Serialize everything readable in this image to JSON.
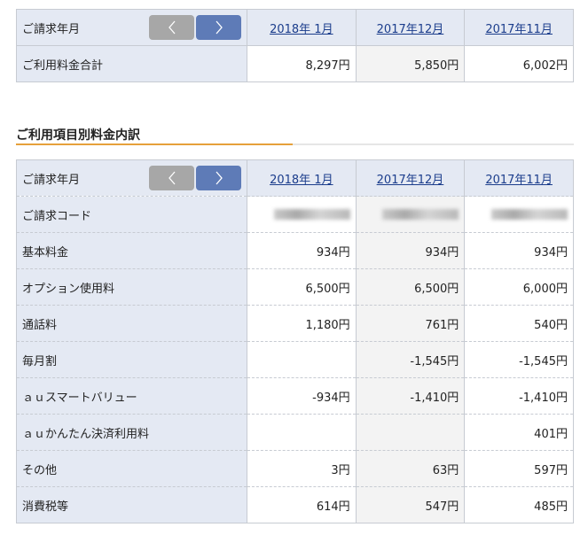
{
  "nav": {
    "prev_icon": "chevron-left-icon",
    "next_icon": "chevron-right-icon"
  },
  "summary": {
    "header_label": "ご請求年月",
    "months": [
      "2018年 1月",
      "2017年12月",
      "2017年11月"
    ],
    "total_label": "ご利用料金合計",
    "totals": [
      "8,297円",
      "5,850円",
      "6,002円"
    ]
  },
  "breakdown": {
    "title": "ご利用項目別料金内訳",
    "header_label": "ご請求年月",
    "months": [
      "2018年 1月",
      "2017年12月",
      "2017年11月"
    ],
    "code_label": "ご請求コード",
    "rows": [
      {
        "label": "基本料金",
        "values": [
          "934円",
          "934円",
          "934円"
        ]
      },
      {
        "label": "オプション使用料",
        "values": [
          "6,500円",
          "6,500円",
          "6,000円"
        ]
      },
      {
        "label": "通話料",
        "values": [
          "1,180円",
          "761円",
          "540円"
        ]
      },
      {
        "label": "毎月割",
        "values": [
          "",
          "-1,545円",
          "-1,545円"
        ]
      },
      {
        "label": "ａｕスマートバリュー",
        "values": [
          "-934円",
          "-1,410円",
          "-1,410円"
        ]
      },
      {
        "label": "ａｕかんたん決済利用料",
        "values": [
          "",
          "",
          "401円"
        ]
      },
      {
        "label": "その他",
        "values": [
          "3円",
          "63円",
          "597円"
        ]
      },
      {
        "label": "消費税等",
        "values": [
          "614円",
          "547円",
          "485円"
        ]
      }
    ]
  },
  "colors": {
    "accent_orange": "#e6a03b",
    "label_bg": "#e4e9f3",
    "next_button": "#5e7bb7",
    "prev_button": "#a7a7a7",
    "link": "#1b3d8c"
  }
}
